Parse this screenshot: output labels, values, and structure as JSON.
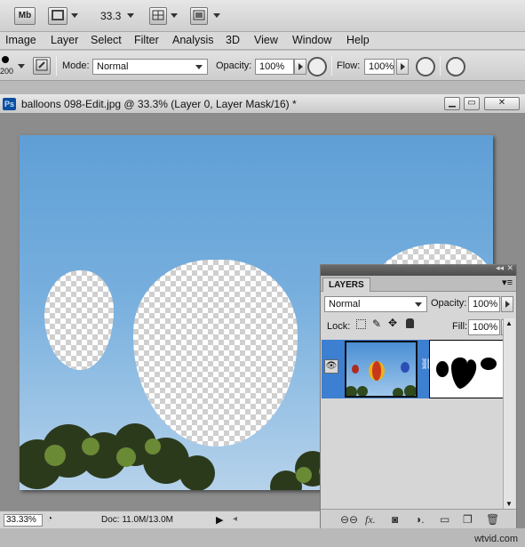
{
  "appbar": {
    "mb_badge": "Mb",
    "zoom": "33.3"
  },
  "menu": [
    "Image",
    "Layer",
    "Select",
    "Filter",
    "Analysis",
    "3D",
    "View",
    "Window",
    "Help"
  ],
  "options": {
    "brush_size": "200",
    "mode_label": "Mode:",
    "mode_value": "Normal",
    "opacity_label": "Opacity:",
    "opacity_value": "100%",
    "flow_label": "Flow:",
    "flow_value": "100%"
  },
  "document": {
    "ps_badge": "Ps",
    "title": "balloons 098-Edit.jpg @ 33.3% (Layer 0, Layer Mask/16) *"
  },
  "status": {
    "zoom": "33.33%",
    "doc_info": "Doc: 11.0M/13.0M"
  },
  "layers_panel": {
    "tab": "LAYERS",
    "blend_mode": "Normal",
    "opacity_label": "Opacity:",
    "opacity_value": "100%",
    "lock_label": "Lock:",
    "fill_label": "Fill:",
    "fill_value": "100%"
  },
  "watermark": "wtvid.com"
}
